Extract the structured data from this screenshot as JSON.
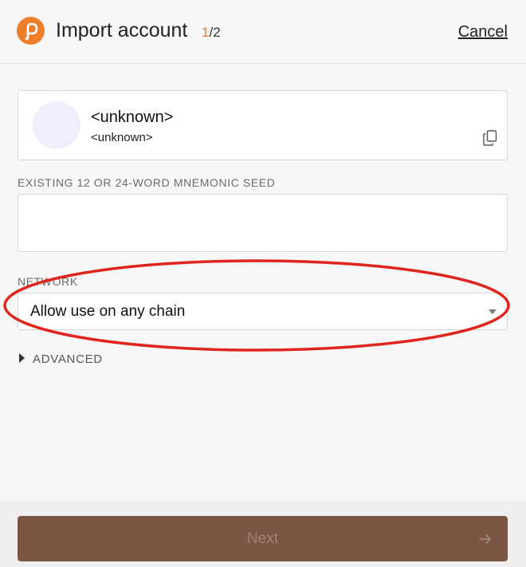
{
  "header": {
    "title": "Import account",
    "step_current": "1",
    "step_total": "/2",
    "cancel_label": "Cancel",
    "logo_icon": "polkadot-logo-icon",
    "accent_color": "#ef7e2b"
  },
  "account": {
    "name": "<unknown>",
    "address": "<unknown>",
    "copy_icon": "copy-icon"
  },
  "seed": {
    "label": "EXISTING 12 OR 24-WORD MNEMONIC SEED",
    "value": ""
  },
  "network": {
    "label": "NETWORK",
    "selected": "Allow use on any chain"
  },
  "advanced": {
    "label": "ADVANCED"
  },
  "footer": {
    "next_label": "Next",
    "next_color": "#7b5644",
    "arrow_icon": "arrow-right-icon"
  },
  "annotation": {
    "color": "#e0251e"
  }
}
